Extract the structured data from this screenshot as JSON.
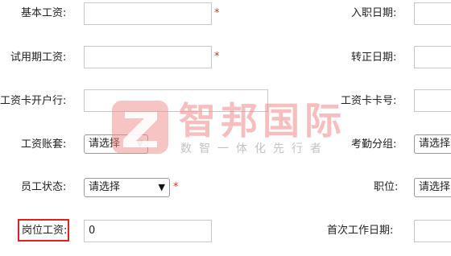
{
  "left_fields": [
    {
      "label": "基本工资:",
      "value": "",
      "required": true
    },
    {
      "label": "试用期工资:",
      "value": "",
      "required": true
    },
    {
      "label": "工资卡开户行:",
      "value": ""
    },
    {
      "label": "工资账套:",
      "select": "请选择"
    },
    {
      "label": "员工状态:",
      "select": "请选择",
      "required": true
    },
    {
      "label": "岗位工资:",
      "value": "0"
    }
  ],
  "right_fields": [
    {
      "label": "入职日期:"
    },
    {
      "label": "转正日期:"
    },
    {
      "label": "工资卡卡号:"
    },
    {
      "label": "考勤分组:",
      "select": "请选择"
    },
    {
      "label": "职位:",
      "select": "请选择"
    },
    {
      "label": "首次工作日期:"
    }
  ],
  "required_mark": "*",
  "watermark": {
    "title": "智邦国际",
    "subtitle": "数智一体化先行者"
  },
  "colors": {
    "required": "#d93025",
    "highlight": "#e02020",
    "watermark": "#f08a8a"
  }
}
